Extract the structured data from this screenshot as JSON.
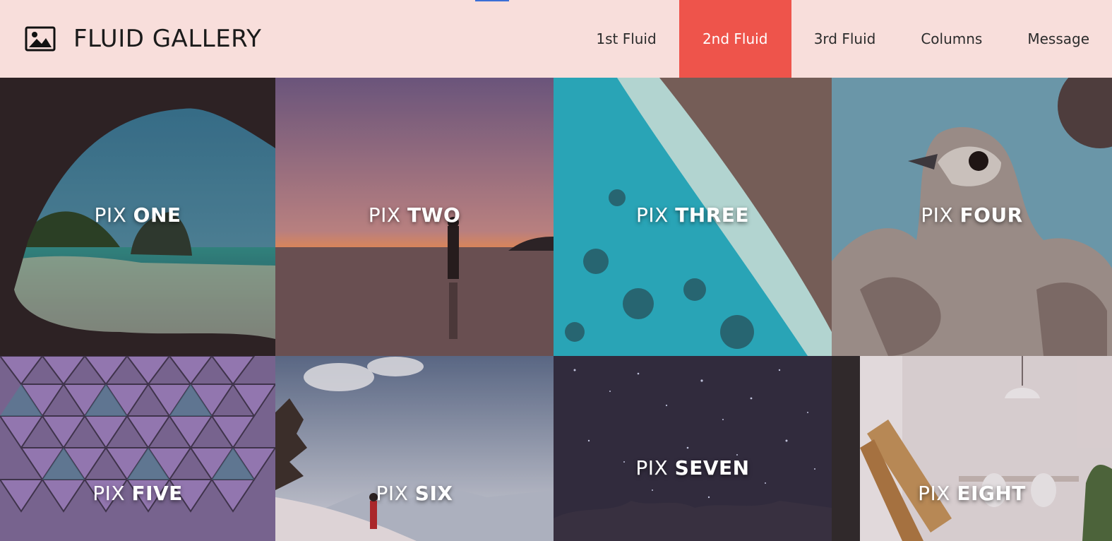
{
  "header": {
    "brand": "FLUID GALLERY",
    "logo_icon": "image-icon"
  },
  "nav": {
    "items": [
      {
        "label": "1st Fluid",
        "active": false
      },
      {
        "label": "2nd Fluid",
        "active": true
      },
      {
        "label": "3rd Fluid",
        "active": false
      },
      {
        "label": "Columns",
        "active": false
      },
      {
        "label": "Message",
        "active": false
      }
    ],
    "active_color": "#ee544b"
  },
  "gallery": {
    "tiles": [
      {
        "prefix": "PIX",
        "word": "ONE",
        "scene": "sea-cave-beach"
      },
      {
        "prefix": "PIX",
        "word": "TWO",
        "scene": "sunset-beach-walker"
      },
      {
        "prefix": "PIX",
        "word": "THREE",
        "scene": "aerial-reef"
      },
      {
        "prefix": "PIX",
        "word": "FOUR",
        "scene": "falcon-portrait"
      },
      {
        "prefix": "PIX",
        "word": "FIVE",
        "scene": "geodesic-facets"
      },
      {
        "prefix": "PIX",
        "word": "SIX",
        "scene": "snowy-mountain-hiker"
      },
      {
        "prefix": "PIX",
        "word": "SEVEN",
        "scene": "starry-night"
      },
      {
        "prefix": "PIX",
        "word": "EIGHT",
        "scene": "interior-chair"
      }
    ]
  }
}
